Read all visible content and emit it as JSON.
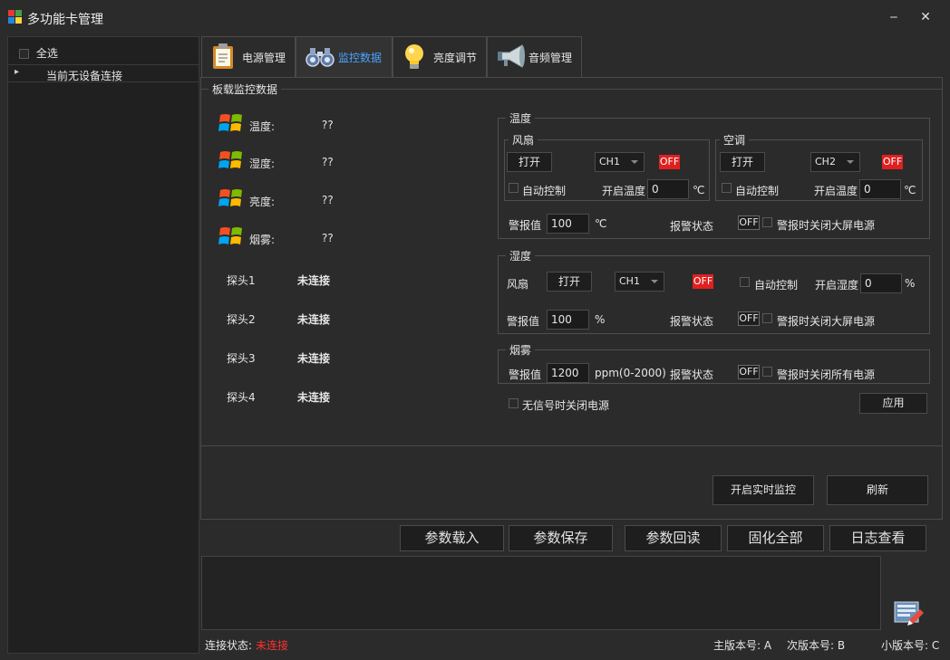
{
  "window": {
    "title": "多功能卡管理",
    "minimize_glyph": "‒",
    "close_glyph": "✕"
  },
  "sidebar": {
    "select_all": "全选",
    "tree_expand_glyph": "▸",
    "no_device": "当前无设备连接"
  },
  "tabs": [
    {
      "label": "电源管理",
      "icon": "clipboard-icon"
    },
    {
      "label": "监控数据",
      "icon": "binoculars-icon"
    },
    {
      "label": "亮度调节",
      "icon": "lightbulb-icon"
    },
    {
      "label": "音频管理",
      "icon": "megaphone-icon"
    }
  ],
  "monitor": {
    "group_title": "板载监控数据",
    "sensors": [
      {
        "label": "温度:",
        "value": "??"
      },
      {
        "label": "湿度:",
        "value": "??"
      },
      {
        "label": "亮度:",
        "value": "??"
      },
      {
        "label": "烟雾:",
        "value": "??"
      }
    ],
    "probes": [
      {
        "label": "探头1",
        "status": "未连接"
      },
      {
        "label": "探头2",
        "status": "未连接"
      },
      {
        "label": "探头3",
        "status": "未连接"
      },
      {
        "label": "探头4",
        "status": "未连接"
      }
    ]
  },
  "temperature": {
    "title": "温度",
    "fan": {
      "title": "风扇",
      "open_btn": "打开",
      "channel": "CH1",
      "state": "OFF",
      "auto": "自动控制",
      "start_temp_label": "开启温度",
      "start_temp": "0",
      "unit": "℃"
    },
    "ac": {
      "title": "空调",
      "open_btn": "打开",
      "channel": "CH2",
      "state": "OFF",
      "auto": "自动控制",
      "start_temp_label": "开启温度",
      "start_temp": "0",
      "unit": "℃"
    },
    "alarm_label": "警报值",
    "alarm_value": "100",
    "alarm_unit": "℃",
    "alarm_status_label": "报警状态",
    "alarm_status": "OFF",
    "cut_power": "警报时关闭大屏电源"
  },
  "humidity": {
    "title": "湿度",
    "fan_label": "风扇",
    "open_btn": "打开",
    "channel": "CH1",
    "state": "OFF",
    "auto": "自动控制",
    "start_label": "开启湿度",
    "start_value": "0",
    "unit": "%",
    "alarm_label": "警报值",
    "alarm_value": "100",
    "alarm_unit": "%",
    "alarm_status_label": "报警状态",
    "alarm_status": "OFF",
    "cut_power": "警报时关闭大屏电源"
  },
  "smoke": {
    "title": "烟雾",
    "alarm_label": "警报值",
    "alarm_value": "1200",
    "alarm_unit": "ppm(0-2000)",
    "alarm_status_label": "报警状态",
    "alarm_status": "OFF",
    "cut_power": "警报时关闭所有电源"
  },
  "no_signal": "无信号时关闭电源",
  "apply_btn": "应用",
  "start_monitor_btn": "开启实时监控",
  "refresh_btn": "刷新",
  "bottom_buttons": [
    "参数载入",
    "参数保存",
    "参数回读",
    "固化全部",
    "日志查看"
  ],
  "status": {
    "conn_label": "连接状态:",
    "conn_value": "未连接",
    "major": "主版本号: A",
    "minor": "次版本号: B",
    "patch": "小版本号: C"
  },
  "colors": {
    "accent_tab": "#4aa3ff",
    "alarm_red": "#e02020",
    "status_red": "#ff3030"
  }
}
